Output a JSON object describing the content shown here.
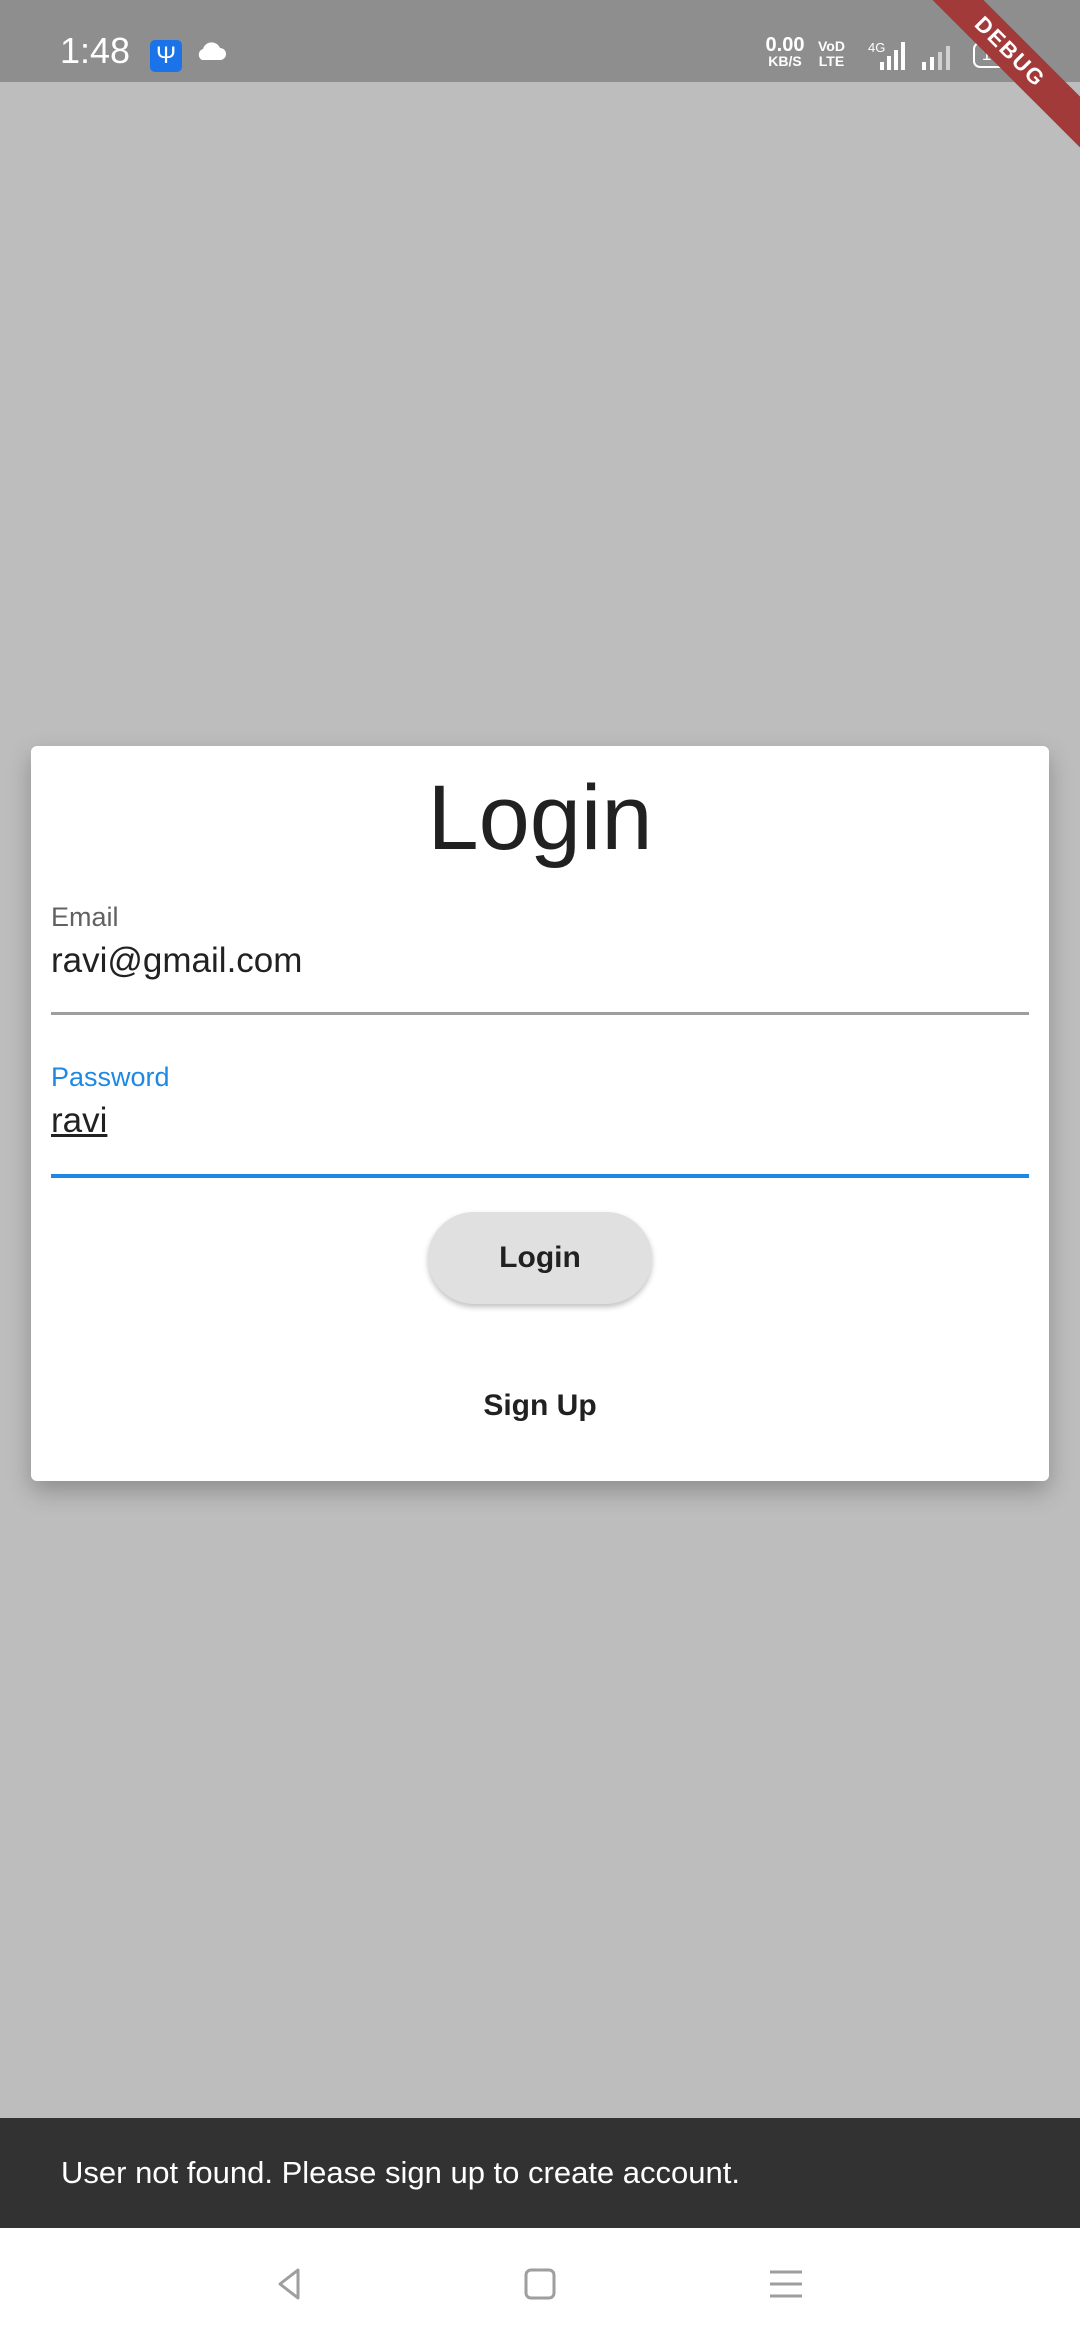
{
  "status_bar": {
    "time": "1:48",
    "net_speed_value": "0.00",
    "net_speed_unit": "KB/S",
    "volte_line1": "VoD",
    "volte_line2": "LTE",
    "network_type": "4G",
    "battery": "100",
    "icons": [
      "usb-icon",
      "cloud-icon",
      "signal-4g-icon",
      "signal-icon",
      "battery-icon"
    ]
  },
  "debug_banner": "DEBUG",
  "login_card": {
    "title": "Login",
    "email": {
      "label": "Email",
      "value": "ravi@gmail.com"
    },
    "password": {
      "label": "Password",
      "value": "ravi"
    },
    "login_button": "Login",
    "signup_button": "Sign Up"
  },
  "snackbar": {
    "message": "User not found. Please sign up to create account."
  },
  "nav_bar": {
    "icons": [
      "back-icon",
      "home-icon",
      "recents-icon"
    ]
  },
  "colors": {
    "background": "#bdbdbd",
    "accent": "#1e88e5",
    "card": "#ffffff",
    "snackbar": "#323232",
    "debug_ribbon": "#a33a3a"
  }
}
